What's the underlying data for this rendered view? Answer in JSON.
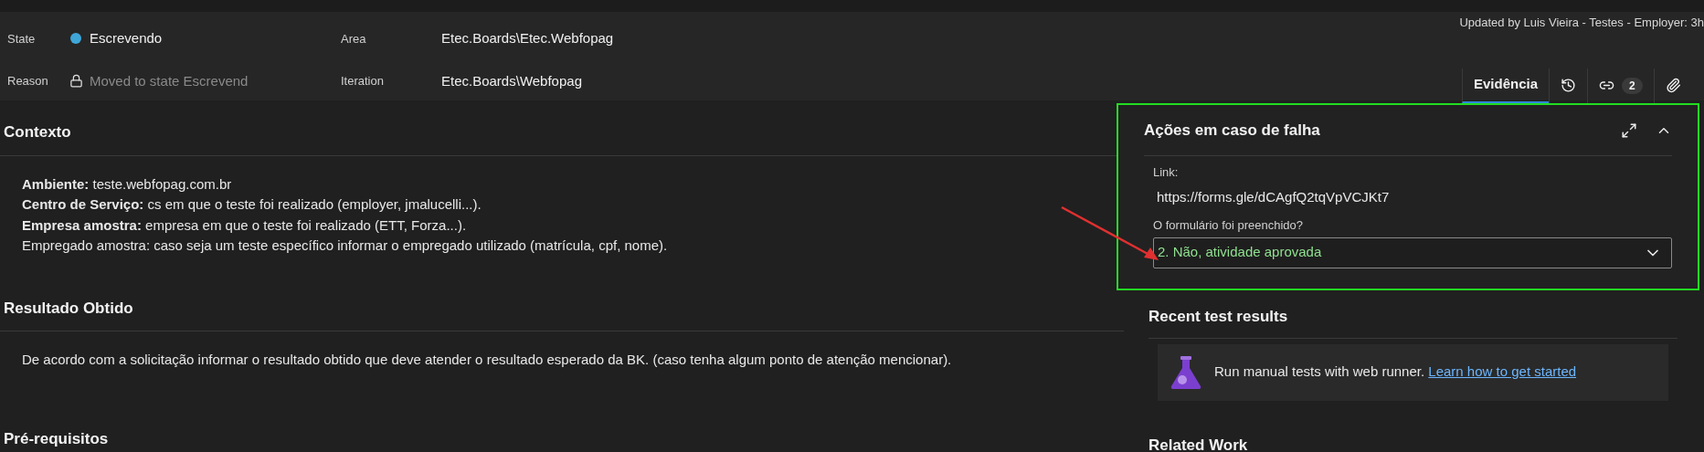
{
  "header": {
    "fields": [
      {
        "label": "State",
        "kind": "state",
        "value": "Escrevendo",
        "color": "#3fa6d8"
      },
      {
        "label": "Area",
        "kind": "plain",
        "value": "Etec.Boards\\Etec.Webfopag"
      },
      {
        "label": "Reason",
        "kind": "locked",
        "value": "Moved to state Escrevend",
        "disabled": true
      },
      {
        "label": "Iteration",
        "kind": "plain",
        "value": "Etec.Boards\\Webfopag"
      }
    ],
    "updated": "Updated by Luis Vieira - Testes - Employer: 3h",
    "tabs": [
      {
        "kind": "text",
        "label": "Evidência",
        "selected": true
      },
      {
        "kind": "history",
        "selected": false
      },
      {
        "kind": "links",
        "count": "2",
        "selected": false
      },
      {
        "kind": "attachments",
        "selected": false
      }
    ]
  },
  "sections": [
    {
      "title": "Contexto",
      "lines": [
        "**Ambiente:** teste.webfopag.com.br",
        "**Centro de Serviço:** cs em que o teste foi realizado (employer, jmalucelli...).",
        "**Empresa amostra:** empresa em que o teste foi realizado (ETT, Forza...).",
        "Empregado amostra: caso seja um teste específico informar o empregado utilizado (matrícula, cpf, nome)."
      ]
    },
    {
      "title": "Resultado Obtido",
      "lines": [
        "De acordo com a solicitação informar o resultado obtido que deve atender o resultado esperado da BK. (caso tenha algum ponto de atenção mencionar)."
      ]
    },
    {
      "title": "Pré-requisitos"
    }
  ],
  "failure_actions": {
    "title": "Ações em caso de falha",
    "link_label": "Link:",
    "link": "https://forms.gle/dCAgfQ2tqVpVCJKt7",
    "question": "O formulário foi preenchido?",
    "answer": "2. Não, atividade aprovada",
    "highlighted": true
  },
  "recent_tests": {
    "title": "Recent test results",
    "message": "Run manual tests with web runner.",
    "link": "Learn how to get started"
  },
  "related_work": {
    "title": "Related Work"
  }
}
